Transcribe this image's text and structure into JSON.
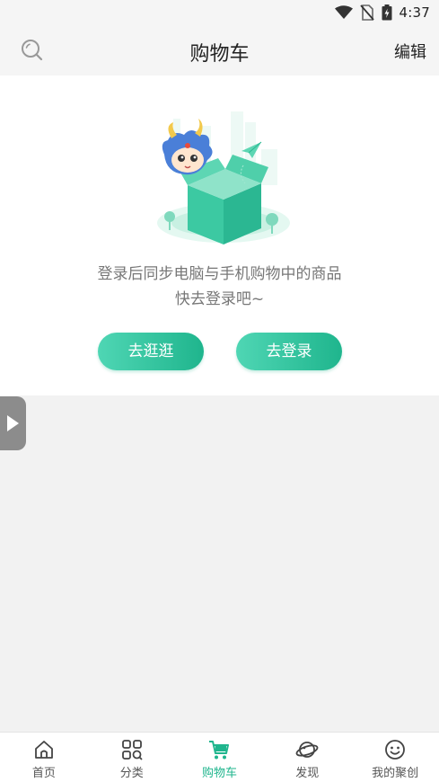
{
  "status_bar": {
    "time": "4:37",
    "icons": [
      "wifi-icon",
      "no-sim-icon",
      "battery-icon"
    ]
  },
  "nav": {
    "title": "购物车",
    "edit_label": "编辑",
    "search_icon": "search-icon"
  },
  "empty_state": {
    "line1": "登录后同步电脑与手机购物中的商品",
    "line2": "快去登录吧~",
    "browse_button": "去逛逛",
    "login_button": "去登录"
  },
  "tabs": [
    {
      "label": "首页",
      "icon": "home-icon",
      "active": false
    },
    {
      "label": "分类",
      "icon": "category-icon",
      "active": false
    },
    {
      "label": "购物车",
      "icon": "cart-icon",
      "active": true
    },
    {
      "label": "发现",
      "icon": "planet-icon",
      "active": false
    },
    {
      "label": "我的聚创",
      "icon": "smile-icon",
      "active": false
    }
  ],
  "colors": {
    "accent": "#1fb58d",
    "accent_light": "#4fd6b4",
    "background": "#f2f2f2"
  }
}
